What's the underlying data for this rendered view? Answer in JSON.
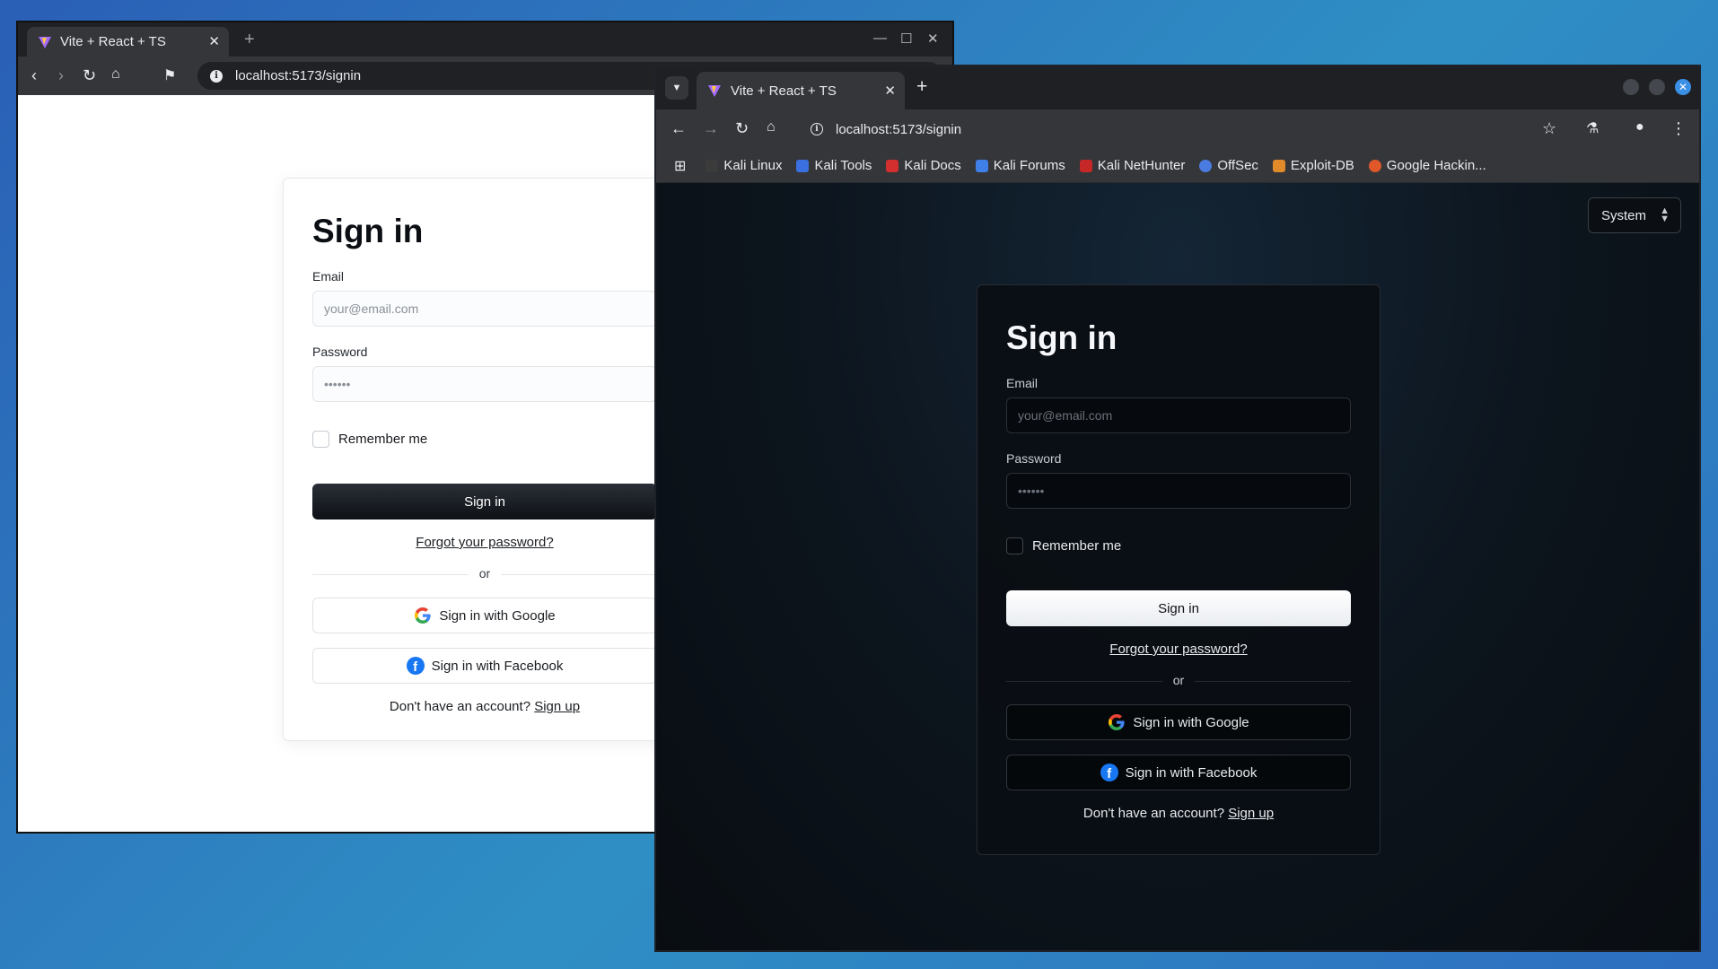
{
  "browser_light": {
    "tab_title": "Vite + React + TS",
    "url": "localhost:5173/signin"
  },
  "browser_dark": {
    "tab_title": "Vite + React + TS",
    "url": "localhost:5173/signin",
    "bookmarks": [
      "Kali Linux",
      "Kali Tools",
      "Kali Docs",
      "Kali Forums",
      "Kali NetHunter",
      "OffSec",
      "Exploit-DB",
      "Google Hackin..."
    ],
    "theme_select": "System"
  },
  "signin": {
    "title": "Sign in",
    "email_label": "Email",
    "email_placeholder": "your@email.com",
    "password_label": "Password",
    "password_placeholder": "••••••",
    "remember_label": "Remember me",
    "submit_label": "Sign in",
    "forgot_label": "Forgot your password?",
    "divider_text": "or",
    "google_label": "Sign in with Google",
    "facebook_label": "Sign in with Facebook",
    "no_account_text": "Don't have an account?",
    "signup_label": "Sign up"
  },
  "colors": {
    "desktop_bg": "#2f8fc4",
    "dark_accent_close": "#3a8fe6",
    "facebook_blue": "#1877f2"
  }
}
